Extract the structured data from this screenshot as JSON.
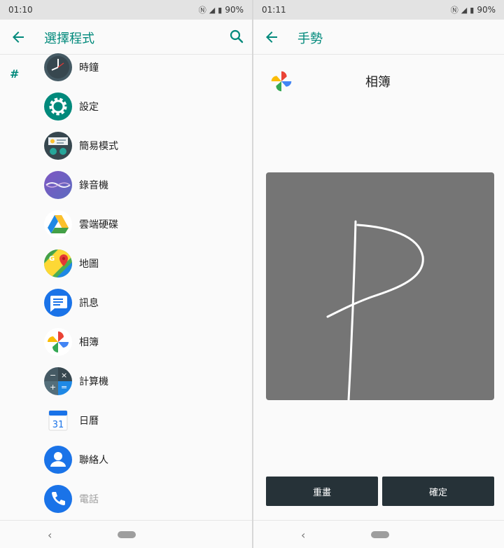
{
  "left_screen": {
    "status": {
      "time": "01:10",
      "battery": "90%"
    },
    "appbar": {
      "title": "選擇程式"
    },
    "section_letter": "#",
    "apps": [
      {
        "label": "時鐘",
        "icon": "clock-icon"
      },
      {
        "label": "設定",
        "icon": "settings-gear-icon"
      },
      {
        "label": "簡易模式",
        "icon": "simple-mode-icon"
      },
      {
        "label": "錄音機",
        "icon": "recorder-icon"
      },
      {
        "label": "雲端硬碟",
        "icon": "drive-icon"
      },
      {
        "label": "地圖",
        "icon": "maps-icon"
      },
      {
        "label": "訊息",
        "icon": "messages-icon"
      },
      {
        "label": "相簿",
        "icon": "photos-icon"
      },
      {
        "label": "計算機",
        "icon": "calculator-icon"
      },
      {
        "label": "日曆",
        "icon": "calendar-icon",
        "day": "31"
      },
      {
        "label": "聯絡人",
        "icon": "contacts-icon"
      },
      {
        "label": "電話",
        "icon": "phone-icon"
      }
    ]
  },
  "right_screen": {
    "status": {
      "time": "01:11",
      "battery": "90%"
    },
    "appbar": {
      "title": "手勢"
    },
    "selected_app": {
      "label": "相簿",
      "icon": "photos-icon"
    },
    "buttons": {
      "redraw": "重畫",
      "confirm": "確定"
    }
  },
  "colors": {
    "accent": "#00897b",
    "canvas": "#757575",
    "button": "#263238"
  }
}
